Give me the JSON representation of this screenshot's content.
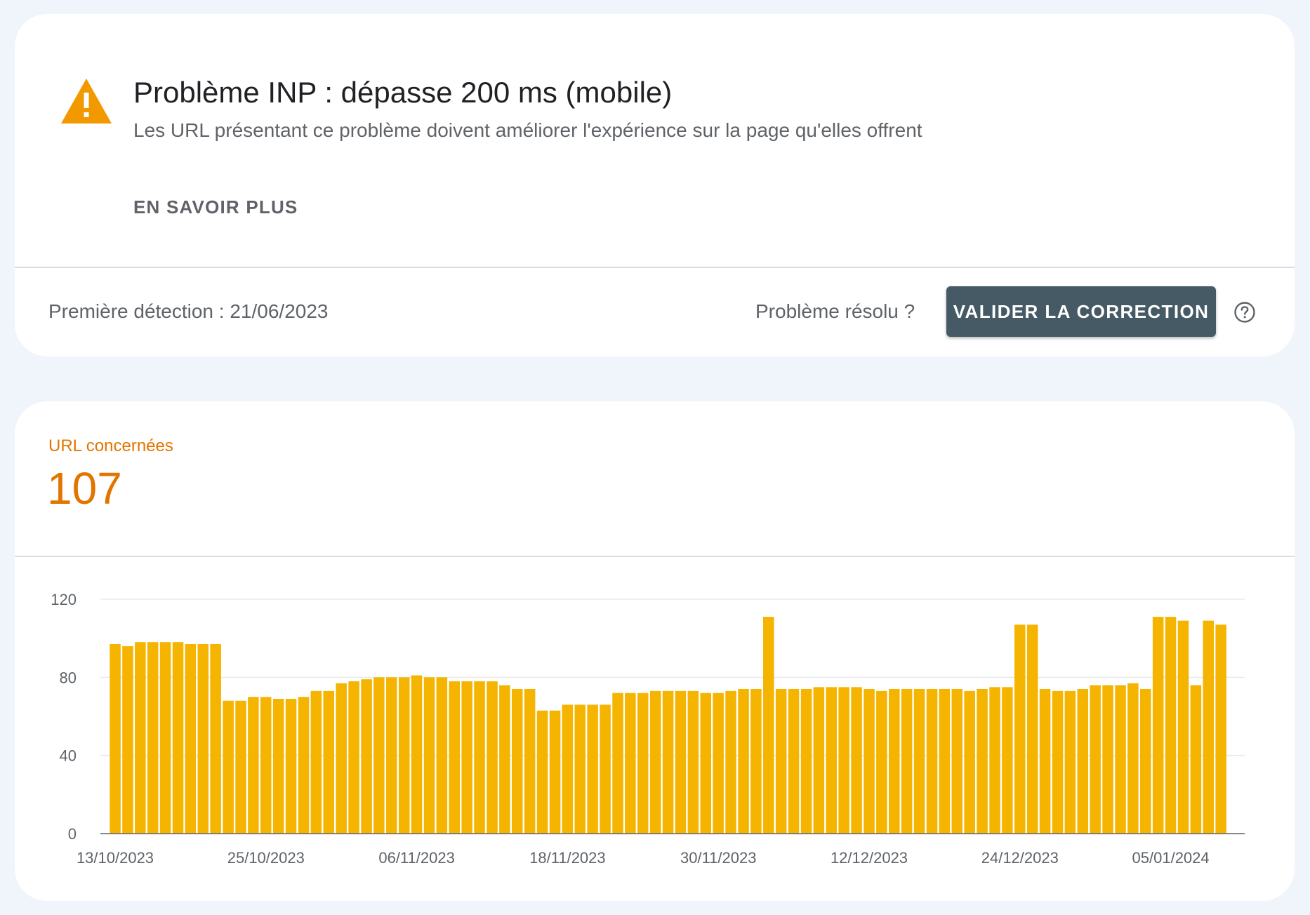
{
  "issue": {
    "title": "Problème INP : dépasse 200 ms (mobile)",
    "description": "Les URL présentant ce problème doivent améliorer l'expérience sur la page qu'elles offrent",
    "learn_more": "EN SAVOIR PLUS",
    "first_detected": "Première détection : 21/06/2023",
    "resolved_question": "Problème résolu ?",
    "validate_button": "VALIDER LA CORRECTION"
  },
  "metric": {
    "label": "URL concernées",
    "value": "107"
  },
  "colors": {
    "accent": "#e37400",
    "bar": "#f4b400",
    "warning": "#f29900",
    "button": "#455a64"
  },
  "chart_data": {
    "type": "bar",
    "ylim": [
      0,
      120
    ],
    "yticks": [
      0,
      40,
      80,
      120
    ],
    "xtick_labels": [
      "13/10/2023",
      "25/10/2023",
      "06/11/2023",
      "18/11/2023",
      "30/11/2023",
      "12/12/2023",
      "24/12/2023",
      "05/01/2024"
    ],
    "grid": true,
    "values": [
      97,
      96,
      98,
      98,
      98,
      98,
      97,
      97,
      97,
      68,
      68,
      70,
      70,
      69,
      69,
      70,
      73,
      73,
      77,
      78,
      79,
      80,
      80,
      80,
      81,
      80,
      80,
      78,
      78,
      78,
      78,
      76,
      74,
      74,
      63,
      63,
      66,
      66,
      66,
      66,
      72,
      72,
      72,
      73,
      73,
      73,
      73,
      72,
      72,
      73,
      74,
      74,
      111,
      74,
      74,
      74,
      75,
      75,
      75,
      75,
      74,
      73,
      74,
      74,
      74,
      74,
      74,
      74,
      73,
      74,
      75,
      75,
      107,
      107,
      74,
      73,
      73,
      74,
      76,
      76,
      76,
      77,
      74,
      111,
      111,
      109,
      76,
      109,
      107
    ]
  }
}
